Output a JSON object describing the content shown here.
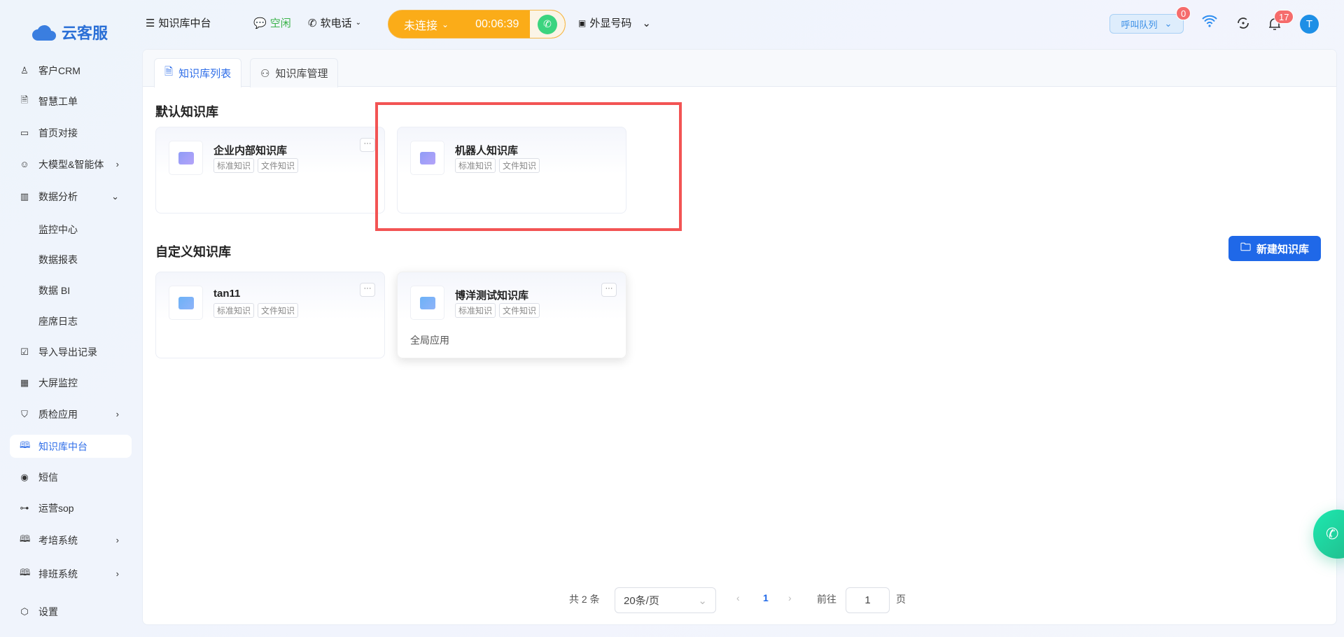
{
  "header": {
    "logo": "云客服",
    "title": "知识库中台",
    "status": "空闲",
    "softphone": "软电话",
    "call_state": "未连接",
    "timer": "00:06:39",
    "caller_id": "外显号码",
    "queue": "呼叫队列",
    "queue_count": "0",
    "notif_count": "17",
    "avatar": "T"
  },
  "sidebar": {
    "items": [
      {
        "label": "客户CRM",
        "icon": "user-icon"
      },
      {
        "label": "智慧工单",
        "icon": "document-icon"
      },
      {
        "label": "首页对接",
        "icon": "monitor-icon"
      },
      {
        "label": "大模型&智能体",
        "icon": "robot-icon"
      },
      {
        "label": "数据分析",
        "icon": "bar-chart-icon"
      },
      {
        "label": "监控中心"
      },
      {
        "label": "数据报表"
      },
      {
        "label": "数据 BI"
      },
      {
        "label": "座席日志"
      },
      {
        "label": "导入导出记录",
        "icon": "calendar-check-icon"
      },
      {
        "label": "大屏监控",
        "icon": "screen-chart-icon"
      },
      {
        "label": "质检应用",
        "icon": "shield-file-icon"
      },
      {
        "label": "知识库中台",
        "icon": "book-icon"
      },
      {
        "label": "短信",
        "icon": "sms-icon"
      },
      {
        "label": "运营sop",
        "icon": "flow-icon"
      },
      {
        "label": "考培系统",
        "icon": "book-icon"
      },
      {
        "label": "排班系统",
        "icon": "book-icon"
      },
      {
        "label": "设置",
        "icon": "gear-icon"
      }
    ]
  },
  "tabs": [
    {
      "label": "知识库列表"
    },
    {
      "label": "知识库管理"
    }
  ],
  "default_section": {
    "title": "默认知识库",
    "cards": [
      {
        "name": "企业内部知识库",
        "tags": [
          "标准知识",
          "文件知识"
        ]
      },
      {
        "name": "机器人知识库",
        "tags": [
          "标准知识",
          "文件知识"
        ]
      }
    ]
  },
  "custom_section": {
    "title": "自定义知识库",
    "new_button": "新建知识库",
    "cards": [
      {
        "name": "tan11",
        "tags": [
          "标准知识",
          "文件知识"
        ]
      },
      {
        "name": "博洋测试知识库",
        "tags": [
          "标准知识",
          "文件知识"
        ],
        "scope": "全局应用"
      }
    ]
  },
  "pagination": {
    "total": "共 2 条",
    "page_size": "20条/页",
    "current": "1",
    "goto_label": "前往",
    "goto_value": "1",
    "page_suffix": "页"
  },
  "colors": {
    "accent": "#1f68e8",
    "highlight": "#f25454",
    "call_pill": "#fbac18"
  }
}
